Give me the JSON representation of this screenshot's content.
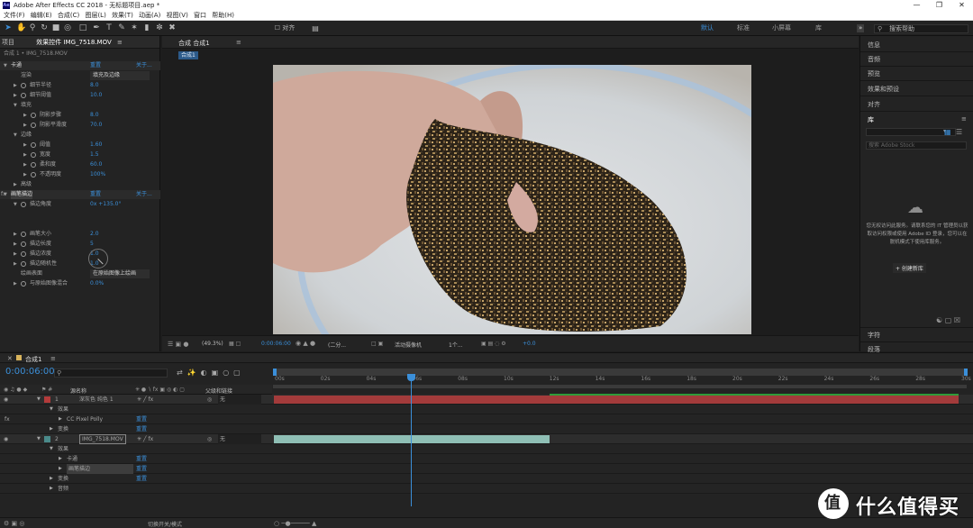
{
  "window": {
    "title": "Adobe After Effects CC 2018 - 无标题项目.aep *",
    "logo": "Ae"
  },
  "menu": [
    "文件(F)",
    "编辑(E)",
    "合成(C)",
    "图层(L)",
    "效果(T)",
    "动画(A)",
    "视图(V)",
    "窗口",
    "帮助(H)"
  ],
  "workspaces": [
    "默认",
    "标准",
    "小屏幕",
    "库"
  ],
  "search_placeholder": "搜索帮助",
  "left_panel": {
    "tab1": "项目",
    "tab2": "效果控件 IMG_7518.MOV",
    "subtitle": "合成 1 • IMG_7518.MOV",
    "rows": [
      {
        "label": "卡通",
        "reset": "重置",
        "about": "关于...",
        "indent": 0,
        "tri": "▼"
      },
      {
        "label": "渲染",
        "value": "填充及边缘",
        "indent": 1
      },
      {
        "label": "细节半径",
        "value": "8.0",
        "indent": 1,
        "sw": true,
        "tri": "▶"
      },
      {
        "label": "细节阈值",
        "value": "10.0",
        "indent": 1,
        "sw": true,
        "tri": "▶"
      },
      {
        "label": "填充",
        "indent": 1,
        "tri": "▼"
      },
      {
        "label": "阴影步骤",
        "value": "8.0",
        "indent": 2,
        "sw": true,
        "tri": "▶"
      },
      {
        "label": "阴影平滑度",
        "value": "70.0",
        "indent": 2,
        "sw": true,
        "tri": "▶"
      },
      {
        "label": "边缘",
        "indent": 1,
        "tri": "▼"
      },
      {
        "label": "阈值",
        "value": "1.60",
        "indent": 2,
        "sw": true,
        "tri": "▶"
      },
      {
        "label": "宽度",
        "value": "1.5",
        "indent": 2,
        "sw": true,
        "tri": "▶"
      },
      {
        "label": "柔和度",
        "value": "60.0",
        "indent": 2,
        "sw": true,
        "tri": "▶"
      },
      {
        "label": "不透明度",
        "value": "100%",
        "indent": 2,
        "sw": true,
        "tri": "▶"
      },
      {
        "label": "高级",
        "indent": 1,
        "tri": "▶"
      },
      {
        "label": "画笔描边",
        "reset": "重置",
        "about": "关于...",
        "indent": 0,
        "tri": "▼",
        "fx": true
      },
      {
        "label": "描边角度",
        "value": "0x +135.0°",
        "indent": 1,
        "sw": true,
        "tri": "▼"
      },
      {
        "label": "",
        "indent": 1
      },
      {
        "label": "",
        "indent": 1
      },
      {
        "label": "画笔大小",
        "value": "2.0",
        "indent": 1,
        "sw": true,
        "tri": "▶"
      },
      {
        "label": "描边长度",
        "value": "5",
        "indent": 1,
        "sw": true,
        "tri": "▶"
      },
      {
        "label": "描边浓度",
        "value": "1.0",
        "indent": 1,
        "sw": true,
        "tri": "▶"
      },
      {
        "label": "描边随机性",
        "value": "1.0",
        "indent": 1,
        "sw": true,
        "tri": "▶"
      },
      {
        "label": "绘画表面",
        "value": "在原始图像上绘画",
        "indent": 1
      },
      {
        "label": "与原始图像混合",
        "value": "0.0%",
        "indent": 1,
        "sw": true,
        "tri": "▶"
      }
    ]
  },
  "viewer": {
    "tab": "合成 合成1",
    "sub_tab": "合成1",
    "bottom": {
      "zoom": "(49.3%)",
      "time": "0:00:06:00",
      "res": "(二分...",
      "camera": "活动摄像机",
      "views": "1个...",
      "exposure": "+0.0"
    }
  },
  "right_panel": {
    "items": [
      "信息",
      "音频",
      "预览",
      "效果和预设",
      "对齐",
      "库"
    ],
    "lib_search": "搜索 Adobe Stock",
    "message": "您无权访问此服务。请联系您的 IT 管理员以获取访问权限或使用 Adobe ID 登录，您可以在脱机模式下使用库服务。",
    "create_btn": "+ 创建新库",
    "bottom_items": [
      "字符",
      "段落"
    ]
  },
  "timeline": {
    "tab": "合成1",
    "timecode": "0:00:06:00",
    "col_source": "源名称",
    "col_parent": "父级和链接",
    "ticks": [
      "00s",
      "02s",
      "04s",
      "06s",
      "08s",
      "10s",
      "12s",
      "14s",
      "16s",
      "18s",
      "20s",
      "22s",
      "24s",
      "26s",
      "28s",
      "30s"
    ],
    "layers": [
      {
        "kind": "layer",
        "num": "1",
        "name": "深灰色 纯色 1",
        "parent": "无",
        "color": "#b33b3b"
      },
      {
        "kind": "group",
        "name": "效果"
      },
      {
        "kind": "effect",
        "name": "CC Pixel Polly",
        "reset": "重置"
      },
      {
        "kind": "group",
        "name": "变换",
        "reset": "重置"
      },
      {
        "kind": "layer",
        "num": "2",
        "name": "IMG_7518.MOV",
        "parent": "无",
        "color": "#4a8a8a"
      },
      {
        "kind": "group",
        "name": "效果"
      },
      {
        "kind": "effect2",
        "name": "卡通",
        "reset": "重置"
      },
      {
        "kind": "effect2",
        "name": "画笔描边",
        "reset": "重置"
      },
      {
        "kind": "group",
        "name": "变换",
        "reset": "重置"
      },
      {
        "kind": "group",
        "name": "音频"
      }
    ],
    "footer": "切换开关/模式"
  },
  "watermark": "什么值得买"
}
